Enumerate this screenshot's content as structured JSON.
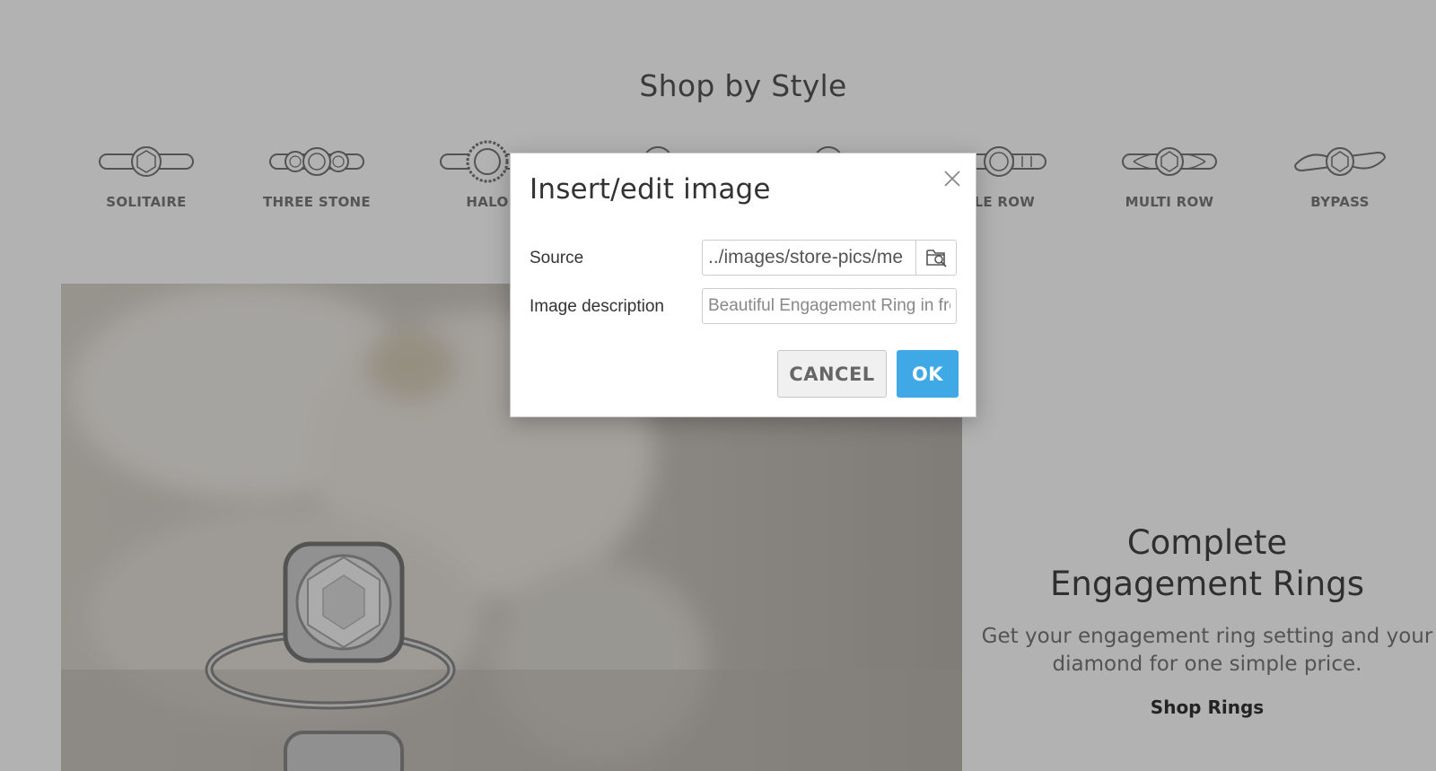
{
  "page": {
    "section_title": "Shop by Style",
    "styles": [
      {
        "label": "SOLITAIRE",
        "icon": "solitaire-ring-icon"
      },
      {
        "label": "THREE STONE",
        "icon": "three-stone-ring-icon"
      },
      {
        "label": "HALO",
        "icon": "halo-ring-icon"
      },
      {
        "label": "",
        "icon": "ring-icon"
      },
      {
        "label": "",
        "icon": "ring-icon"
      },
      {
        "label": "GLE ROW",
        "icon": "single-row-ring-icon"
      },
      {
        "label": "MULTI ROW",
        "icon": "multi-row-ring-icon"
      },
      {
        "label": "BYPASS",
        "icon": "bypass-ring-icon"
      }
    ],
    "promo": {
      "title_line1": "Complete",
      "title_line2": "Engagement Rings",
      "text": "Get your engagement ring setting and your diamond for one simple price.",
      "link": "Shop Rings"
    }
  },
  "dialog": {
    "title": "Insert/edit image",
    "source_label": "Source",
    "source_value": "../images/store-pics/me",
    "description_label": "Image description",
    "description_value": "Beautiful Engagement Ring in fro",
    "cancel_label": "CANCEL",
    "ok_label": "OK"
  },
  "colors": {
    "overlay": "rgba(0,0,0,0.30)",
    "ok_button": "#3fa9e6",
    "cancel_button": "#f0f0f0"
  }
}
